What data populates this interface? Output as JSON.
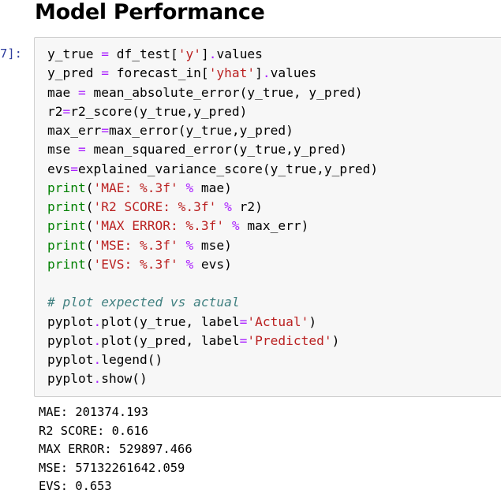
{
  "heading": "Model Performance",
  "prompt_label": "7]:",
  "code_lines": [
    [
      [
        "v",
        "y_true "
      ],
      [
        "o",
        "="
      ],
      [
        "v",
        " df_test["
      ],
      [
        "s",
        "'y'"
      ],
      [
        "v",
        "]"
      ],
      [
        "o",
        "."
      ],
      [
        "v",
        "values"
      ]
    ],
    [
      [
        "v",
        "y_pred "
      ],
      [
        "o",
        "="
      ],
      [
        "v",
        " forecast_in["
      ],
      [
        "s",
        "'yhat'"
      ],
      [
        "v",
        "]"
      ],
      [
        "o",
        "."
      ],
      [
        "v",
        "values"
      ]
    ],
    [
      [
        "v",
        "mae "
      ],
      [
        "o",
        "="
      ],
      [
        "v",
        " mean_absolute_error(y_true, y_pred)"
      ]
    ],
    [
      [
        "v",
        "r2"
      ],
      [
        "o",
        "="
      ],
      [
        "v",
        "r2_score(y_true,y_pred)"
      ]
    ],
    [
      [
        "v",
        "max_err"
      ],
      [
        "o",
        "="
      ],
      [
        "v",
        "max_error(y_true,y_pred)"
      ]
    ],
    [
      [
        "v",
        "mse "
      ],
      [
        "o",
        "="
      ],
      [
        "v",
        " mean_squared_error(y_true,y_pred)"
      ]
    ],
    [
      [
        "v",
        "evs"
      ],
      [
        "o",
        "="
      ],
      [
        "v",
        "explained_variance_score(y_true,y_pred)"
      ]
    ],
    [
      [
        "b",
        "print"
      ],
      [
        "v",
        "("
      ],
      [
        "s",
        "'MAE: %.3f'"
      ],
      [
        "v",
        " "
      ],
      [
        "o",
        "%"
      ],
      [
        "v",
        " mae)"
      ]
    ],
    [
      [
        "b",
        "print"
      ],
      [
        "v",
        "("
      ],
      [
        "s",
        "'R2 SCORE: %.3f'"
      ],
      [
        "v",
        " "
      ],
      [
        "o",
        "%"
      ],
      [
        "v",
        " r2)"
      ]
    ],
    [
      [
        "b",
        "print"
      ],
      [
        "v",
        "("
      ],
      [
        "s",
        "'MAX ERROR: %.3f'"
      ],
      [
        "v",
        " "
      ],
      [
        "o",
        "%"
      ],
      [
        "v",
        " max_err)"
      ]
    ],
    [
      [
        "b",
        "print"
      ],
      [
        "v",
        "("
      ],
      [
        "s",
        "'MSE: %.3f'"
      ],
      [
        "v",
        " "
      ],
      [
        "o",
        "%"
      ],
      [
        "v",
        " mse)"
      ]
    ],
    [
      [
        "b",
        "print"
      ],
      [
        "v",
        "("
      ],
      [
        "s",
        "'EVS: %.3f'"
      ],
      [
        "v",
        " "
      ],
      [
        "o",
        "%"
      ],
      [
        "v",
        " evs)"
      ]
    ],
    [],
    [
      [
        "c",
        "# plot expected vs actual"
      ]
    ],
    [
      [
        "v",
        "pyplot"
      ],
      [
        "o",
        "."
      ],
      [
        "v",
        "plot(y_true, label"
      ],
      [
        "o",
        "="
      ],
      [
        "s",
        "'Actual'"
      ],
      [
        "v",
        ")"
      ]
    ],
    [
      [
        "v",
        "pyplot"
      ],
      [
        "o",
        "."
      ],
      [
        "v",
        "plot(y_pred, label"
      ],
      [
        "o",
        "="
      ],
      [
        "s",
        "'Predicted'"
      ],
      [
        "v",
        ")"
      ]
    ],
    [
      [
        "v",
        "pyplot"
      ],
      [
        "o",
        "."
      ],
      [
        "v",
        "legend()"
      ]
    ],
    [
      [
        "v",
        "pyplot"
      ],
      [
        "o",
        "."
      ],
      [
        "v",
        "show()"
      ]
    ]
  ],
  "output_lines": [
    "MAE: 201374.193",
    "R2 SCORE: 0.616",
    "MAX ERROR: 529897.466",
    "MSE: 57132261642.059",
    "EVS: 0.653"
  ],
  "colors": {
    "keyword_builtin": "#008000",
    "string": "#ba2121",
    "operator": "#aa22ff",
    "comment": "#408080",
    "prompt": "#303f9f",
    "cell_background": "#f7f7f7"
  }
}
